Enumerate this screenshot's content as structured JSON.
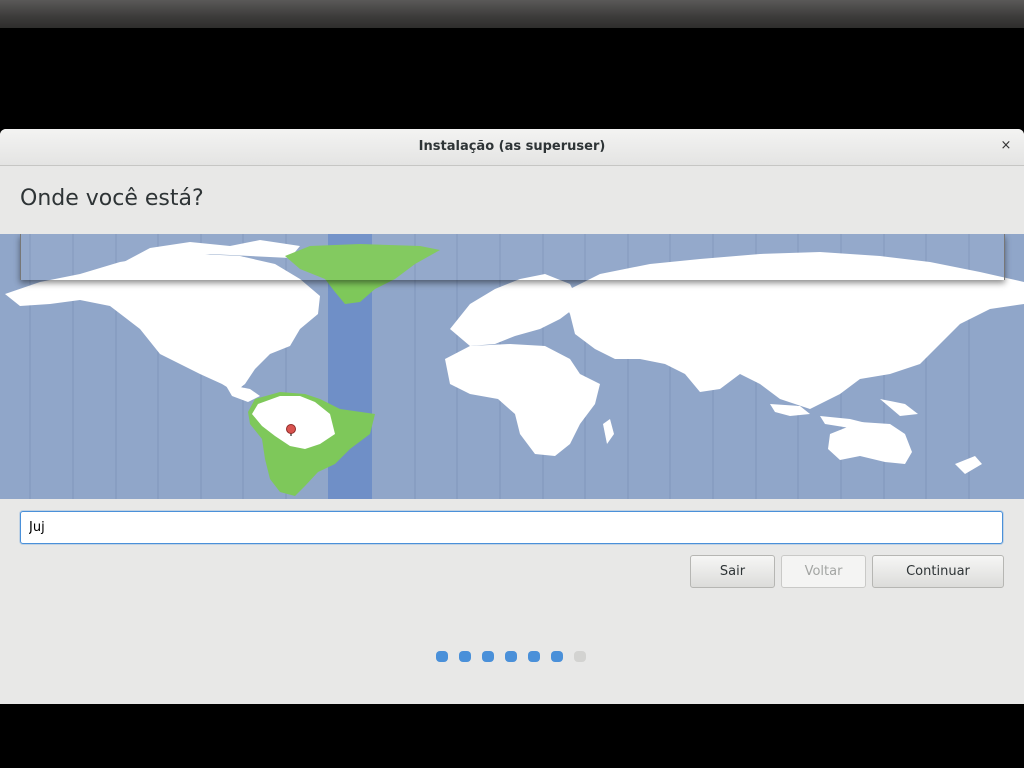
{
  "window": {
    "title": "Instalação (as superuser)",
    "close_icon": "×"
  },
  "page": {
    "heading": "Onde você está?"
  },
  "map": {
    "selected_timezone_color": "#6f8fc7",
    "highlight_region_color": "#7ec85a",
    "land_color": "#ffffff",
    "ocean_color": "#90a6c9",
    "pin_color": "#d9534f"
  },
  "location": {
    "value": "Juj"
  },
  "buttons": {
    "quit": "Sair",
    "back": "Voltar",
    "continue": "Continuar"
  },
  "progress": {
    "total_steps": 7,
    "completed_steps": 6
  }
}
